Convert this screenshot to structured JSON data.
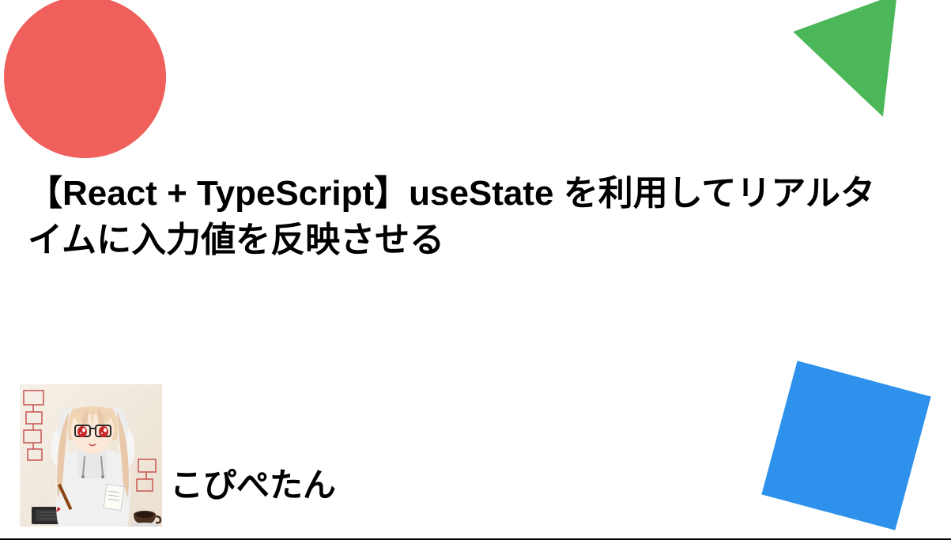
{
  "title": "【React + TypeScript】useState を利用してリアルタイムに入力値を反映させる",
  "author": {
    "name": "こぴぺたん"
  },
  "shapes": {
    "circle_color": "#ef5f5b",
    "triangle_color": "#4cb759",
    "square_color": "#2e91eb"
  }
}
